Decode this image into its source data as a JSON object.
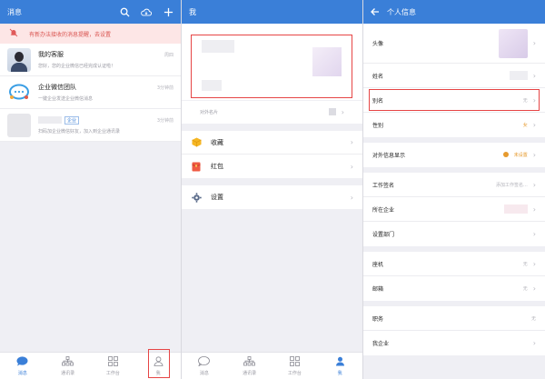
{
  "panel1": {
    "title": "消息",
    "banner": {
      "text": "有新办法接收的消息提醒，去设置"
    },
    "messages": [
      {
        "name": "我的客服",
        "preview": "您好，您的企业微信已经完成认证啦！",
        "time": "周四"
      },
      {
        "name": "企业微信团队",
        "preview": "一键企业发送企业微信消息",
        "time": "3分钟前"
      },
      {
        "name": "",
        "tag": "企业",
        "preview": "扫码加企业微信好友，加入到企业通讯录",
        "time": "3分钟前"
      }
    ],
    "tabs": [
      {
        "label": "消息"
      },
      {
        "label": "通讯录"
      },
      {
        "label": "工作台"
      },
      {
        "label": "我"
      }
    ]
  },
  "panel2": {
    "title": "我",
    "card_footer": "对外名片",
    "group1": [
      {
        "label": "收藏"
      },
      {
        "label": "红包"
      }
    ],
    "group2": [
      {
        "label": "设置"
      }
    ],
    "tabs": [
      {
        "label": "消息"
      },
      {
        "label": "通讯录"
      },
      {
        "label": "工作台"
      },
      {
        "label": "我"
      }
    ]
  },
  "panel3": {
    "title": "个人信息",
    "rows_a": [
      {
        "label": "头像"
      },
      {
        "label": "姓名",
        "value": ""
      },
      {
        "label": "别名",
        "value": "无"
      },
      {
        "label": "性别",
        "value": "女"
      }
    ],
    "rows_b": [
      {
        "label": "对外信息显示",
        "value": "未设置"
      }
    ],
    "rows_c": [
      {
        "label": "工作签名",
        "value": "添加工作签名..."
      },
      {
        "label": "所在企业",
        "value": ""
      },
      {
        "label": "设置部门",
        "value": ""
      }
    ],
    "rows_d": [
      {
        "label": "座机",
        "value": "无"
      },
      {
        "label": "邮箱",
        "value": "无"
      }
    ],
    "rows_e": [
      {
        "label": "职务",
        "value": "无"
      },
      {
        "label": "我企业",
        "value": ""
      }
    ]
  },
  "colors": {
    "accent": "#3a7fd8",
    "highlight": "#e64545",
    "banner_bg": "#fde6e6"
  }
}
